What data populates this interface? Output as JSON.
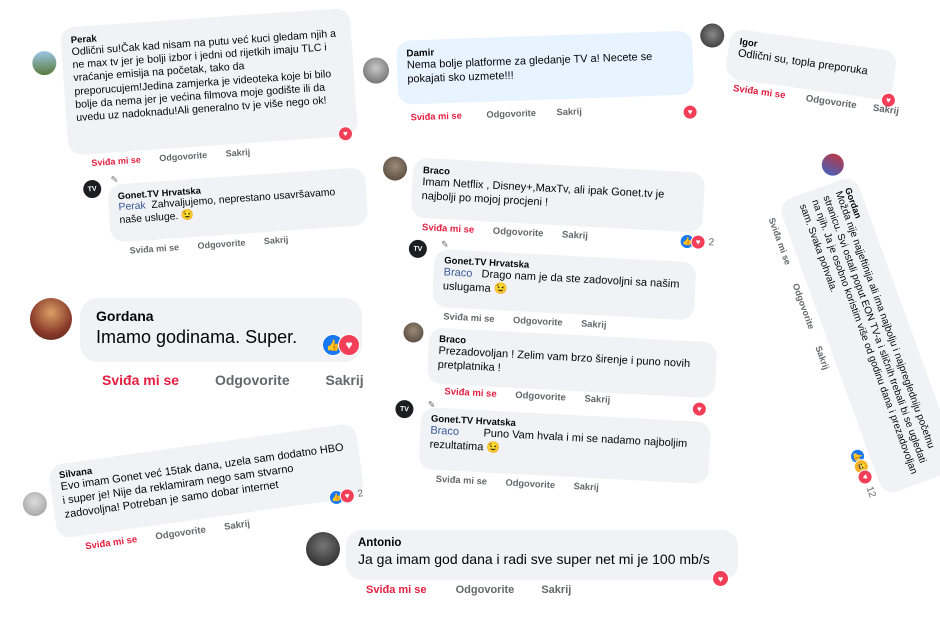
{
  "reactions": {
    "heart": "♥",
    "thumb": "👍",
    "haha": "😆"
  },
  "actions": {
    "like": "Sviđa mi se",
    "reply": "Odgovorite",
    "hide": "Sakrij"
  },
  "gonet_avatar_text": "TV",
  "perak": {
    "name": "Perak",
    "text": "Odlični su!Čak kad nisam na putu već kuci gledam njih a ne max tv jer je bolji izbor i jedni od rijetkih imaju TLC i vraćanje emisija na početak, tako da preporucujem!Jedina zamjerka je videoteka koje bi bilo bolje da nema jer je većina filmova moje godište ili da uvedu uz nadoknadu!Ali generalno tv je više nego ok!"
  },
  "gonet_reply_perak": {
    "name": "Gonet.TV Hrvatska",
    "mention": "Perak",
    "text": "Zahvaljujemo, neprestano usavršavamo naše usluge. 😉"
  },
  "damir": {
    "name": "Damir",
    "text": "Nema bolje platforme za gledanje TV a! Necete se pokajati sko uzmete!!!"
  },
  "igor": {
    "name": "Igor",
    "text": "Odlični su, topla preporuka"
  },
  "braco1": {
    "name": "Braco",
    "text": "Imam Netflix , Disney+,MaxTv, ali ipak Gonet.tv je najbolji po mojoj procjeni !",
    "count": "2"
  },
  "gonet_reply_braco1": {
    "name": "Gonet.TV Hrvatska",
    "mention": "Braco",
    "text": "Drago nam je da ste zadovoljni sa našim uslugama 😉"
  },
  "braco2": {
    "name": "Braco",
    "text": "Prezadovoljan ! Zelim vam brzo širenje i puno novih pretplatnika !"
  },
  "gonet_reply_braco2": {
    "name": "Gonet.TV Hrvatska",
    "mention": "Braco",
    "text": "Puno Vam hvala i mi se nadamo najboljim rezultatima 😉"
  },
  "gordana_big": {
    "name": "Gordana",
    "text": "Imamo godinama. Super."
  },
  "gordan": {
    "name": "Gordan",
    "text": "Možda nije najjeftinija ali ima najbolju i najpregledniju početnu stranicu. Svi ostali poput EON TV-a i sličnih trebali bi se ugledati na njih. Ja je osobno koristim više od godinu dana i prezadovoljan sam. Svaka pohvala.",
    "count": "12"
  },
  "silvana": {
    "name": "Silvana",
    "text": "Evo imam Gonet već 15tak dana, uzela sam dodatno HBO i super je! Nije da reklamiram nego sam stvarno zadovoljna! Potreban je samo dobar internet",
    "count": "2"
  },
  "antonio": {
    "name": "Antonio",
    "text": "Ja ga imam god dana i radi sve super net mi je 100 mb/s"
  }
}
